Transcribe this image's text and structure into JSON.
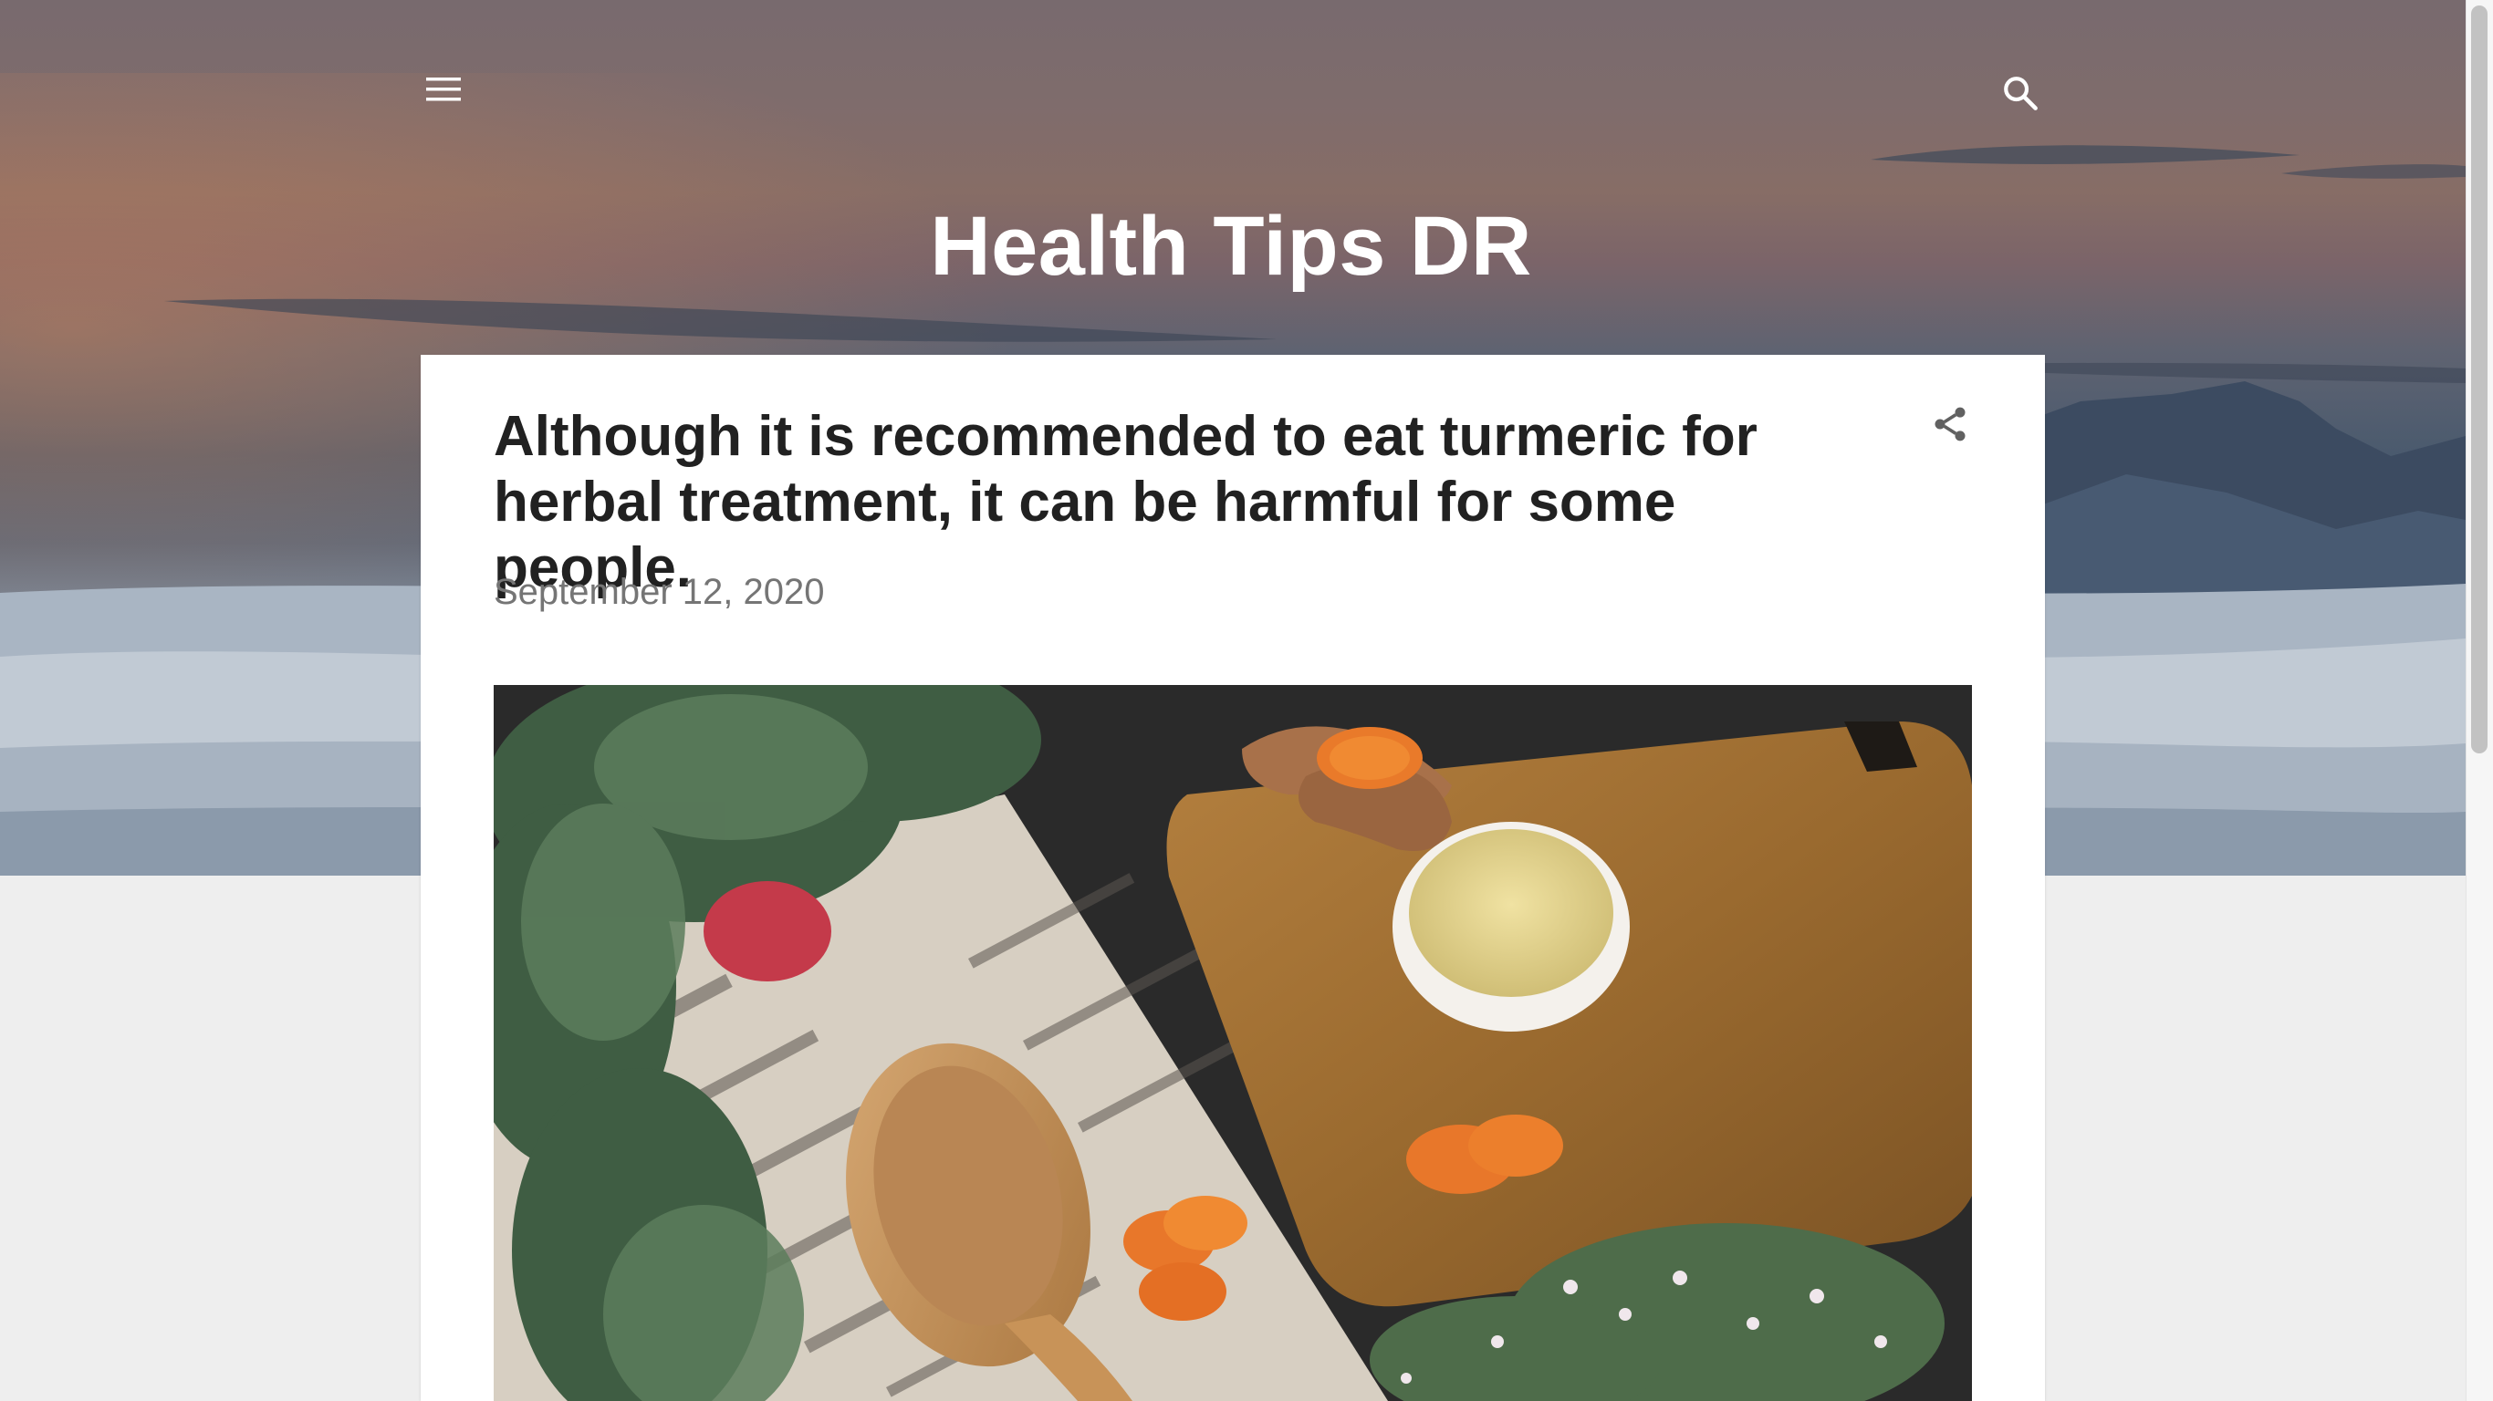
{
  "header": {
    "blog_title": "Health Tips DR",
    "menu_icon": "hamburger-menu-icon",
    "search_icon": "search-icon"
  },
  "post": {
    "title": "Although it is recommended to eat turmeric for herbal treatment, it can be harmful for some people.",
    "date": "September 12, 2020",
    "share_icon": "share-icon",
    "image_subject": "turmeric"
  },
  "colors": {
    "page_background": "#eeeeee",
    "card_background": "#ffffff",
    "title_text": "#212121",
    "date_text": "#757575",
    "header_text": "#ffffff"
  }
}
